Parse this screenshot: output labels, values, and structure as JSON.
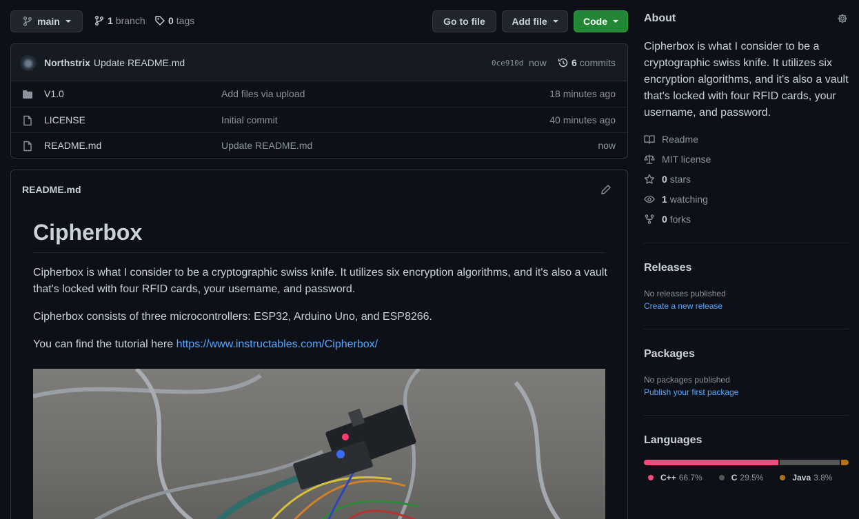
{
  "toolbar": {
    "branch_name": "main",
    "branch_count": "1",
    "branch_label": "branch",
    "tag_count": "0",
    "tag_label": "tags",
    "go_to_file": "Go to file",
    "add_file": "Add file",
    "code": "Code"
  },
  "commit": {
    "author": "Northstrix",
    "message": "Update README.md",
    "hash": "0ce910d",
    "time": "now",
    "commit_count": "6",
    "commit_label": "commits"
  },
  "files": [
    {
      "name": "V1.0",
      "type": "folder",
      "message": "Add files via upload",
      "time": "18 minutes ago"
    },
    {
      "name": "LICENSE",
      "type": "file",
      "message": "Initial commit",
      "time": "40 minutes ago"
    },
    {
      "name": "README.md",
      "type": "file",
      "message": "Update README.md",
      "time": "now"
    }
  ],
  "readme": {
    "header": "README.md",
    "title": "Cipherbox",
    "para1": "Cipherbox is what I consider to be a cryptographic swiss knife. It utilizes six encryption algorithms, and it's also a vault that's locked with four RFID cards, your username, and password.",
    "para2": "Cipherbox consists of three microcontrollers: ESP32, Arduino Uno, and ESP8266.",
    "para3_prefix": "You can find the tutorial here ",
    "para3_link": "https://www.instructables.com/Cipherbox/"
  },
  "about": {
    "heading": "About",
    "description": "Cipherbox is what I consider to be a cryptographic swiss knife. It utilizes six encryption algorithms, and it's also a vault that's locked with four RFID cards, your username, and password.",
    "readme": "Readme",
    "license": "MIT license",
    "stars_count": "0",
    "stars_label": "stars",
    "watching_count": "1",
    "watching_label": "watching",
    "forks_count": "0",
    "forks_label": "forks"
  },
  "releases": {
    "heading": "Releases",
    "empty": "No releases published",
    "link": "Create a new release"
  },
  "packages": {
    "heading": "Packages",
    "empty": "No packages published",
    "link": "Publish your first package"
  },
  "languages": {
    "heading": "Languages",
    "items": [
      {
        "name": "C++",
        "percent": "66.7%",
        "value": 66.7,
        "color": "#f34b7d"
      },
      {
        "name": "C",
        "percent": "29.5%",
        "value": 29.5,
        "color": "#555555"
      },
      {
        "name": "Java",
        "percent": "3.8%",
        "value": 3.8,
        "color": "#b07219"
      }
    ]
  },
  "colors": {
    "background": "#0d1117",
    "border": "#30363d",
    "link": "#58a6ff",
    "green_button": "#238636"
  }
}
